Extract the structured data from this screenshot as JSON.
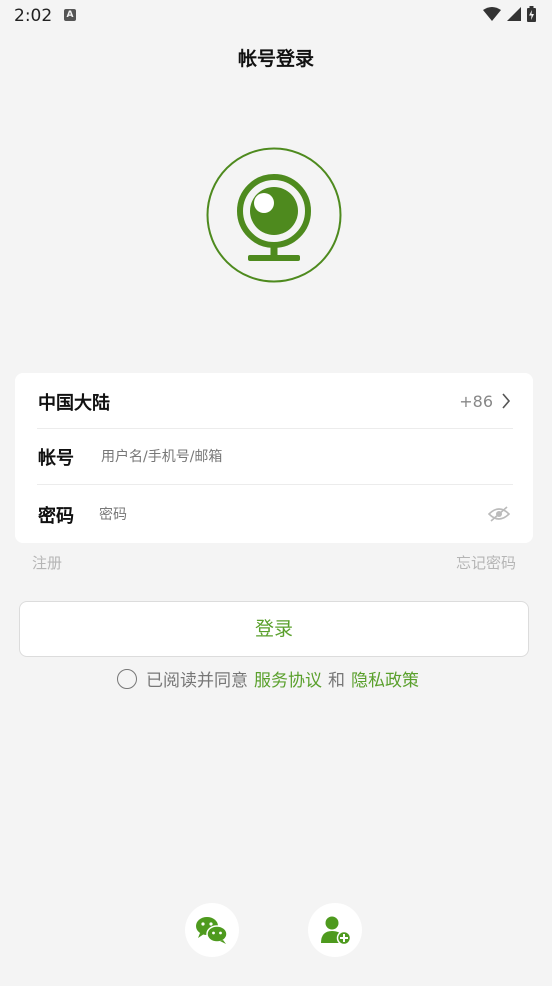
{
  "status_bar": {
    "time": "2:02",
    "notification_icon": "A",
    "icons": [
      "wifi-icon",
      "signal-icon",
      "battery-icon"
    ]
  },
  "header": {
    "title": "帐号登录"
  },
  "logo": {
    "icon": "webcam-icon",
    "color": "#4e8a1e"
  },
  "form": {
    "region_label": "中国大陆",
    "country_code": "+86",
    "account_label": "帐号",
    "account_placeholder": "用户名/手机号/邮箱",
    "password_label": "密码",
    "password_placeholder": "密码"
  },
  "links": {
    "register": "注册",
    "forgot_password": "忘记密码"
  },
  "login_button": "登录",
  "agreement": {
    "prefix": "已阅读并同意",
    "service_terms": "服务协议",
    "conjunction": "和",
    "privacy_policy": "隐私政策"
  },
  "social": [
    "wechat-icon",
    "add-user-icon"
  ],
  "colors": {
    "accent": "#5aa02c",
    "background": "#f4f4f4"
  }
}
